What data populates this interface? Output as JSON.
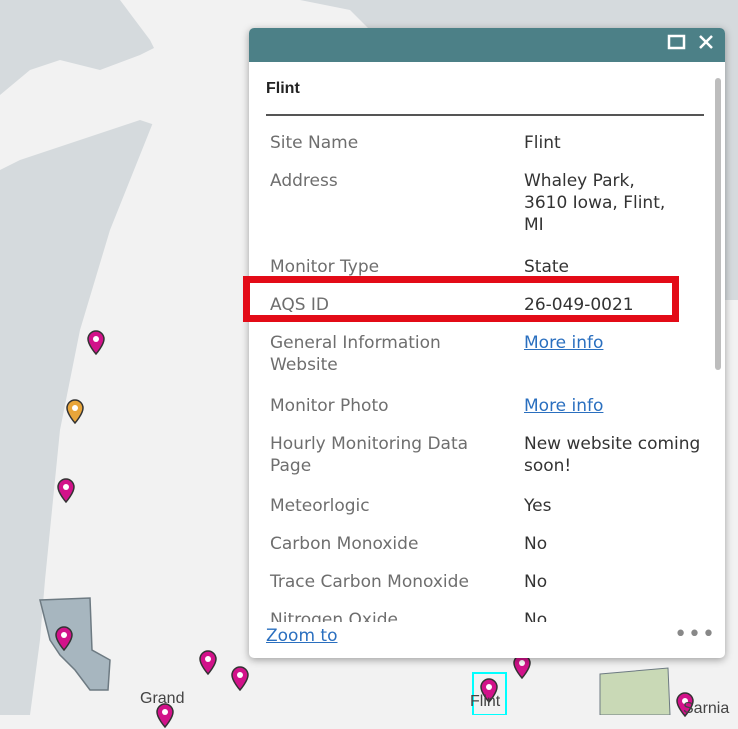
{
  "popup": {
    "title": "Flint",
    "rows": [
      {
        "label": "Site Name",
        "value": "Flint"
      },
      {
        "label": "Address",
        "value": "Whaley Park,\n3610 Iowa, Flint,\nMI"
      },
      {
        "label": "Monitor Type",
        "value": "State"
      },
      {
        "label": "AQS ID",
        "value": "26-049-0021"
      },
      {
        "label": "General Information Website",
        "value": "More info"
      },
      {
        "label": "Monitor Photo",
        "value": "More info"
      },
      {
        "label": "Hourly Monitoring Data Page",
        "value": "New website coming soon!"
      },
      {
        "label": "Meteorlogic",
        "value": "Yes"
      },
      {
        "label": "Carbon Monoxide",
        "value": "No"
      },
      {
        "label": "Trace Carbon Monoxide",
        "value": "No"
      },
      {
        "label": "Nitrogen Oxide",
        "value": "No"
      }
    ],
    "zoom_label": "Zoom to",
    "more_label": "•••",
    "maximize_icon": "maximize-icon",
    "close_icon": "close-icon"
  },
  "map": {
    "labels": {
      "grand": "Grand",
      "flint": "Flint",
      "sarnia": "Sarnia"
    },
    "colors": {
      "land": "#f2f2f2",
      "water": "#d5dadd",
      "pin_magenta": "#d2128a",
      "pin_orange": "#e8a53a",
      "selection": "#00ffff",
      "county": "#a7b6bf",
      "county_green": "#c9d9b6"
    }
  },
  "highlight": {
    "color": "#e30b17"
  }
}
